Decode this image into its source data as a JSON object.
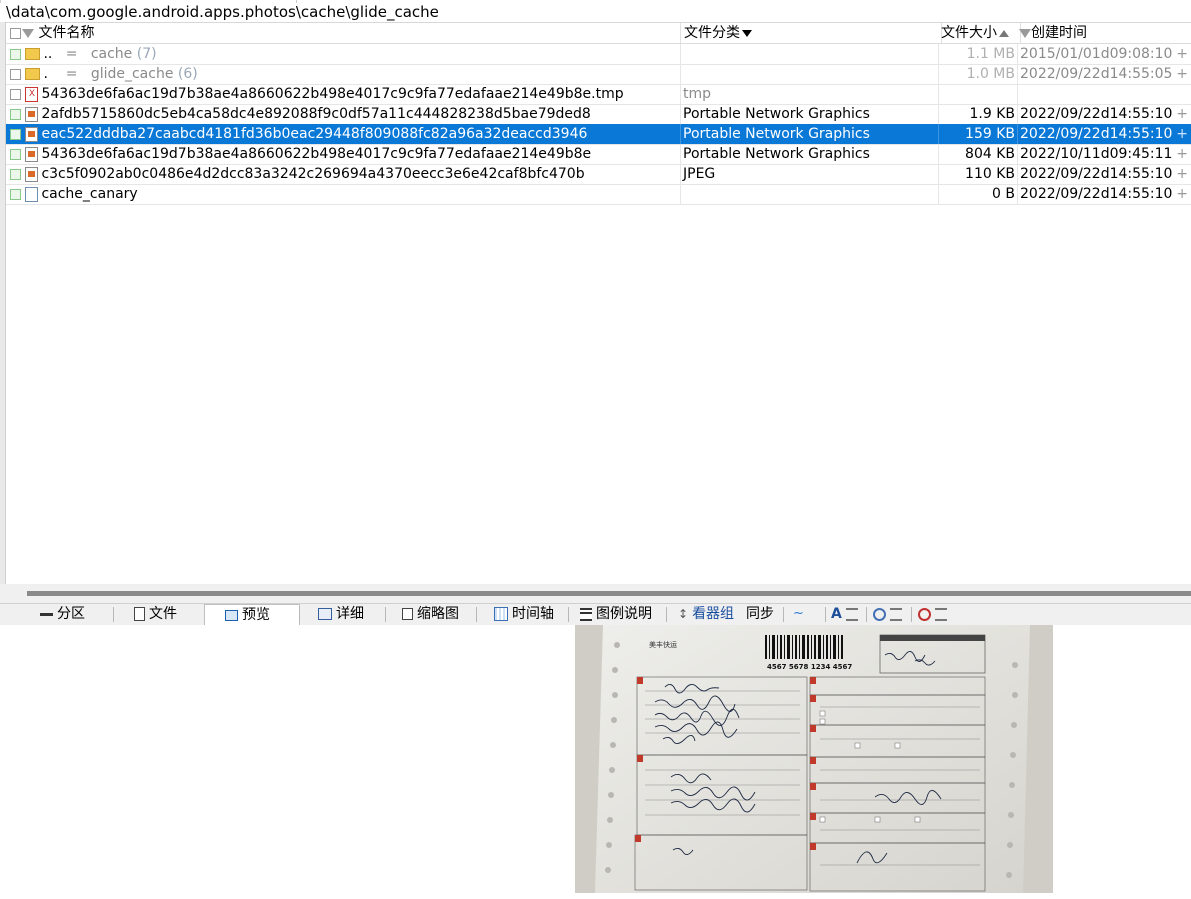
{
  "path": "\\data\\com.google.android.apps.photos\\cache\\glide_cache",
  "columns": {
    "name": "文件名称",
    "type": "文件分类",
    "size": "文件大小",
    "created": "创建时间"
  },
  "rows": [
    {
      "name": "..",
      "eq": "=",
      "label": "cache",
      "count": "(7)",
      "type": "",
      "size": "1.1 MB",
      "created": "2015/01/01d09:08:10",
      "kind": "folder"
    },
    {
      "name": ".",
      "eq": "=",
      "label": "glide_cache",
      "count": "(6)",
      "type": "",
      "size": "1.0 MB",
      "created": "2022/09/22d14:55:05",
      "kind": "folder"
    },
    {
      "name": "54363de6fa6ac19d7b38ae4a8660622b498e4017c9c9fa77edafaae214e49b8e.tmp",
      "type": "tmp",
      "size": "",
      "created": "",
      "kind": "bad"
    },
    {
      "name": "2afdb5715860dc5eb4ca58dc4e892088f9c0df57a11c444828238d5bae79ded8",
      "type": "Portable Network Graphics",
      "size": "1.9 KB",
      "created": "2022/09/22d14:55:10",
      "kind": "image"
    },
    {
      "name": "eac522dddba27caabcd4181fd36b0eac29448f809088fc82a96a32deaccd3946",
      "type": "Portable Network Graphics",
      "size": "159 KB",
      "created": "2022/09/22d14:55:10",
      "kind": "image",
      "selected": true
    },
    {
      "name": "54363de6fa6ac19d7b38ae4a8660622b498e4017c9c9fa77edafaae214e49b8e",
      "type": "Portable Network Graphics",
      "size": "804 KB",
      "created": "2022/10/11d09:45:11",
      "kind": "image"
    },
    {
      "name": "c3c5f0902ab0c0486e4d2dcc83a3242c269694a4370eecc3e6e42caf8bfc470b",
      "type": "JPEG",
      "size": "110 KB",
      "created": "2022/09/22d14:55:10",
      "kind": "image"
    },
    {
      "name": "cache_canary",
      "type": "",
      "size": "0 B",
      "created": "2022/09/22d14:55:10",
      "kind": "doc"
    }
  ],
  "plus": "+",
  "tabs": [
    "分区",
    "文件",
    "预览",
    "详细",
    "缩略图",
    "时间轴",
    "图例说明",
    "看器组",
    "同步"
  ],
  "active_tab": "预览",
  "preview_doc": {
    "brand": "美丰快运",
    "barcode": "4567 5678 1234 4567",
    "sections": [
      "1",
      "2",
      "3",
      "4",
      "5",
      "6",
      "7",
      "8",
      "9",
      "10"
    ]
  },
  "colors": {
    "selection": "#0a78d7",
    "grey_text": "#8a8a8a"
  }
}
